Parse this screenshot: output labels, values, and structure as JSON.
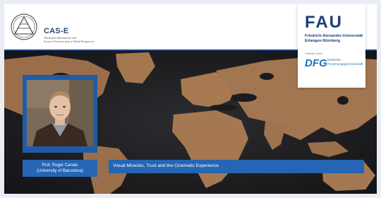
{
  "header": {
    "cas_title": "CAS-E",
    "cas_subtitle_line1": "Alternative Rationalities and",
    "cas_subtitle_line2": "Esoteric Practices from a Global Perspective"
  },
  "fau": {
    "logo": "FAU",
    "name_line1": "Friedrich-Alexander-Universität",
    "name_line2": "Erlangen-Nürnberg",
    "funded_by": "Gefördert durch",
    "dfg_logo": "DFG",
    "dfg_line1": "Deutsche",
    "dfg_line2": "Forschungsgemeinschaft"
  },
  "speaker": {
    "name": "Prof. Roger Canals",
    "affiliation": "(University of Barcelona)"
  },
  "talk": {
    "title": "Visual Miracles, Trust and the Cinematic Experience"
  },
  "colors": {
    "accent": "#2565b3",
    "brand": "#1b3e7a"
  }
}
